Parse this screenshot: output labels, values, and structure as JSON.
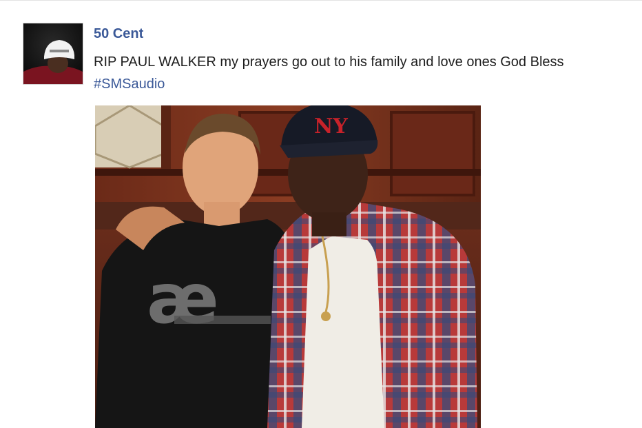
{
  "post": {
    "author": "50 Cent",
    "message_text": "RIP PAUL WALKER my prayers go out to his family and love ones God Bless ",
    "hashtag": "#SMSaudio",
    "avatar_icon": "profile-photo-icon",
    "photo_icon": "post-photo-icon"
  },
  "photo": {
    "cap_logo": "NY",
    "shirt_logo": "æ"
  },
  "colors": {
    "link_blue": "#3b5998",
    "text": "#1d1d1d",
    "background": "#ffffff"
  }
}
